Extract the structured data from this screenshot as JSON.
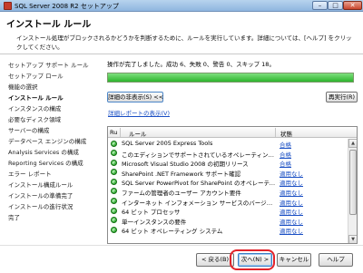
{
  "window": {
    "title": "SQL Server 2008 R2 セットアップ"
  },
  "header": {
    "title": "インストール ルール",
    "description": "インストール処理がブロックされるかどうかを判断するために、ルールを実行しています。詳細については、[ヘルプ] をクリックしてください。"
  },
  "sidebar": {
    "items": [
      {
        "label": "セットアップ サポート ルール"
      },
      {
        "label": "セットアップ ロール"
      },
      {
        "label": "機能の選択"
      },
      {
        "label": "インストール ルール",
        "current": true
      },
      {
        "label": "インスタンスの構成"
      },
      {
        "label": "必要なディスク領域"
      },
      {
        "label": "サーバーの構成"
      },
      {
        "label": "データベース エンジンの構成"
      },
      {
        "label": "Analysis Services の構成"
      },
      {
        "label": "Reporting Services の構成"
      },
      {
        "label": "エラー レポート"
      },
      {
        "label": "インストール構成ルール"
      },
      {
        "label": "インストールの準備完了"
      },
      {
        "label": "インストールの進行状況"
      },
      {
        "label": "完了"
      }
    ]
  },
  "main": {
    "status_text": "操作が完了しました。成功 6、失敗 0、警告 0、スキップ 18。",
    "progress_fraction": 1.0,
    "progress_color": "#2db52d",
    "hide_details_label": "詳細の非表示(S) <<",
    "rerun_label": "再実行(R)",
    "report_link": "詳細レポートの表示(V)",
    "table": {
      "col_ru": "Ru",
      "col_rule": "ルール",
      "col_status": "状態",
      "rows": [
        {
          "rule": "SQL Server 2005 Express Tools",
          "status": "合格"
        },
        {
          "rule": "このエディションでサポートされているオペレーティング システム",
          "status": "合格"
        },
        {
          "rule": "Microsoft Visual Studio 2008 の初期リリース",
          "status": "合格"
        },
        {
          "rule": "SharePoint .NET Framework サポート確認",
          "status": "適用なし"
        },
        {
          "rule": "SQL Server PowerPivot for SharePoint のオペレーティング",
          "status": "適用なし"
        },
        {
          "rule": "ファームの管理者のユーザー アカウント要件",
          "status": "適用なし"
        },
        {
          "rule": "インターネット インフォメーション サービスのバージョン",
          "status": "適用なし"
        },
        {
          "rule": "64 ビット プロセッサ",
          "status": "適用なし"
        },
        {
          "rule": "単一インスタンスの要件",
          "status": "適用なし"
        },
        {
          "rule": "64 ビット オペレーティング システム",
          "status": "適用なし"
        }
      ]
    }
  },
  "footer": {
    "back_label": "< 戻る(B)",
    "next_label": "次へ(N) >",
    "cancel_label": "キャンセル",
    "help_label": "ヘルプ",
    "highlight_color": "#e2232a"
  }
}
